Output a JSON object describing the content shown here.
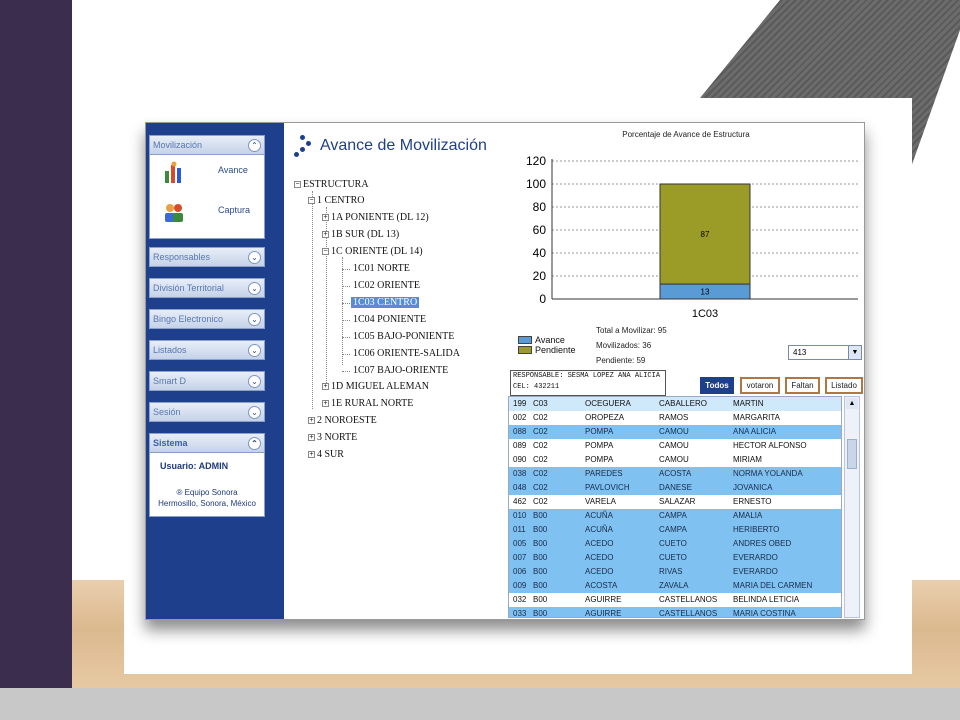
{
  "colors": {
    "nav_bg": "#1e3f8c",
    "avance": "#5b9bd5",
    "pendiente": "#9b9b28",
    "deleted_row": "#7fc2f2"
  },
  "nav": {
    "sections": [
      {
        "label": "Movilización",
        "icon": "chevron-up-icon"
      },
      {
        "label": "Responsables",
        "icon": "chevron-down-icon"
      },
      {
        "label": "División Territorial",
        "icon": "chevron-down-icon"
      },
      {
        "label": "Bingo Electronico",
        "icon": "chevron-down-icon"
      },
      {
        "label": "Listados",
        "icon": "chevron-down-icon"
      },
      {
        "label": "Smart D",
        "icon": "chevron-down-icon"
      },
      {
        "label": "Sesión",
        "icon": "chevron-down-icon"
      },
      {
        "label": "Sistema",
        "icon": "chevron-up-icon"
      }
    ],
    "items": [
      {
        "label": "Avance",
        "icon": "people-chart-icon"
      },
      {
        "label": "Captura",
        "icon": "people-icon"
      }
    ],
    "user_label": "Usuario: ADMIN",
    "copyright_line1": "® Equipo Sonora",
    "copyright_line2": "Hermosillo, Sonora, México"
  },
  "header": {
    "title": "Avance de Movilización"
  },
  "tree": {
    "nodes": [
      {
        "label": "ESTRUCTURA",
        "toggle": "−"
      },
      {
        "label": "1 CENTRO",
        "toggle": "−"
      },
      {
        "label": "1A PONIENTE (DL 12)",
        "toggle": "+"
      },
      {
        "label": "1B SUR (DL 13)",
        "toggle": "+"
      },
      {
        "label": "1C ORIENTE (DL 14)",
        "toggle": "−"
      },
      {
        "label": "1C01 NORTE",
        "toggle": ""
      },
      {
        "label": "1C02 ORIENTE",
        "toggle": ""
      },
      {
        "label": "1C03 CENTRO",
        "toggle": "",
        "selected": true
      },
      {
        "label": "1C04 PONIENTE",
        "toggle": ""
      },
      {
        "label": "1C05 BAJO-PONIENTE",
        "toggle": ""
      },
      {
        "label": "1C06 ORIENTE-SALIDA",
        "toggle": ""
      },
      {
        "label": "1C07 BAJO-ORIENTE",
        "toggle": ""
      },
      {
        "label": "1D MIGUEL ALEMAN",
        "toggle": "+"
      },
      {
        "label": "1E RURAL NORTE",
        "toggle": "+"
      },
      {
        "label": "2 NOROESTE",
        "toggle": "+"
      },
      {
        "label": "3 NORTE",
        "toggle": "+"
      },
      {
        "label": "4 SUR",
        "toggle": "+"
      }
    ]
  },
  "chart_data": {
    "type": "bar",
    "title": "Porcentaje de Avance de Estructura",
    "categories": [
      "1C03"
    ],
    "series": [
      {
        "name": "Avance",
        "values": [
          13
        ],
        "color": "#5b9bd5"
      },
      {
        "name": "Pendiente",
        "values": [
          87
        ],
        "color": "#9b9b28"
      }
    ],
    "stacked": true,
    "ylim": [
      0,
      120
    ],
    "yticks": [
      "0",
      "20",
      "40",
      "60",
      "80",
      "100",
      "120"
    ],
    "grid": true,
    "legend": "bottom-left"
  },
  "summary": {
    "total": "Total a Movilizar: 95",
    "movilizados": "Movilizados: 36",
    "pendiente": "Pendiente: 59",
    "select_value": "413"
  },
  "responsable": {
    "line1": "RESPONSABLE: SESMA LOPEZ ANA ALICIA",
    "line2": "CEL: 432211"
  },
  "buttons": {
    "todos": "Todos",
    "votaron": "votaron",
    "faltan": "Faltan",
    "listado": "Listado"
  },
  "table": {
    "rows": [
      {
        "c1": "199",
        "c2": "C03",
        "c3": "OCEGUERA",
        "c4": "CABALLERO",
        "c5": "MARTIN",
        "del": false,
        "hl": true
      },
      {
        "c1": "002",
        "c2": "C02",
        "c3": "OROPEZA",
        "c4": "RAMOS",
        "c5": "MARGARITA",
        "del": false
      },
      {
        "c1": "088",
        "c2": "C02",
        "c3": "POMPA",
        "c4": "CAMOU",
        "c5": "ANA ALICIA",
        "del": true
      },
      {
        "c1": "089",
        "c2": "C02",
        "c3": "POMPA",
        "c4": "CAMOU",
        "c5": "HECTOR ALFONSO",
        "del": false
      },
      {
        "c1": "090",
        "c2": "C02",
        "c3": "POMPA",
        "c4": "CAMOU",
        "c5": "MIRIAM",
        "del": false
      },
      {
        "c1": "038",
        "c2": "C02",
        "c3": "PAREDES",
        "c4": "ACOSTA",
        "c5": "NORMA YOLANDA",
        "del": true
      },
      {
        "c1": "048",
        "c2": "C02",
        "c3": "PAVLOVICH",
        "c4": "DANESE",
        "c5": "JOVANICA",
        "del": true
      },
      {
        "c1": "462",
        "c2": "C02",
        "c3": "VARELA",
        "c4": "SALAZAR",
        "c5": "ERNESTO",
        "del": false
      },
      {
        "c1": "010",
        "c2": "B00",
        "c3": "ACUÑA",
        "c4": "CAMPA",
        "c5": "AMALIA",
        "del": true
      },
      {
        "c1": "011",
        "c2": "B00",
        "c3": "ACUÑA",
        "c4": "CAMPA",
        "c5": "HERIBERTO",
        "del": true
      },
      {
        "c1": "005",
        "c2": "B00",
        "c3": "ACEDO",
        "c4": "CUETO",
        "c5": "ANDRES OBED",
        "del": true
      },
      {
        "c1": "007",
        "c2": "B00",
        "c3": "ACEDO",
        "c4": "CUETO",
        "c5": "EVERARDO",
        "del": true
      },
      {
        "c1": "006",
        "c2": "B00",
        "c3": "ACEDO",
        "c4": "RIVAS",
        "c5": "EVERARDO",
        "del": true
      },
      {
        "c1": "009",
        "c2": "B00",
        "c3": "ACOSTA",
        "c4": "ZAVALA",
        "c5": "MARIA DEL CARMEN",
        "del": true
      },
      {
        "c1": "032",
        "c2": "B00",
        "c3": "AGUIRRE",
        "c4": "CASTELLANOS",
        "c5": "BELINDA LETICIA",
        "del": false
      },
      {
        "c1": "033",
        "c2": "B00",
        "c3": "AGUIRRE",
        "c4": "CASTELLANOS",
        "c5": "MARIA COSTINA",
        "del": true
      }
    ]
  }
}
